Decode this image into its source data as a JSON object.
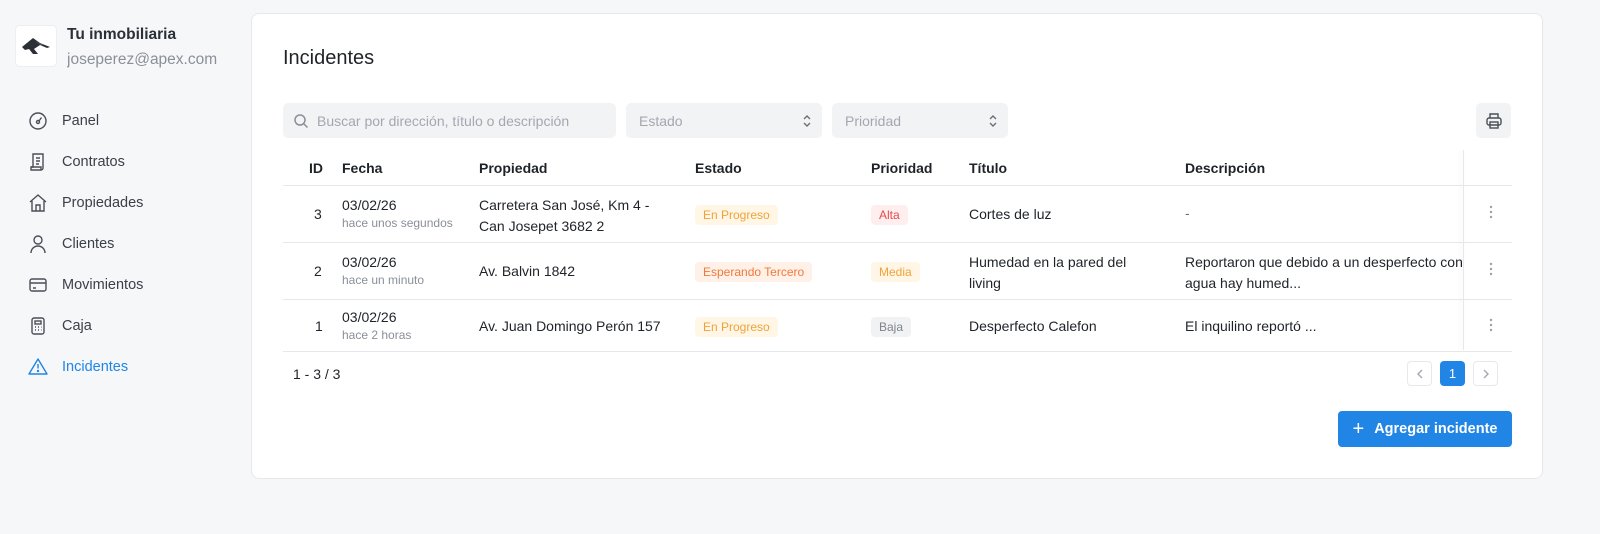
{
  "brand": {
    "name": "Tu inmobiliaria",
    "email": "joseperez@apex.com",
    "logo_icon": "house-logo-icon"
  },
  "nav": [
    {
      "label": "Panel",
      "icon": "gauge-icon",
      "active": false
    },
    {
      "label": "Contratos",
      "icon": "contract-icon",
      "active": false
    },
    {
      "label": "Propiedades",
      "icon": "home-icon",
      "active": false
    },
    {
      "label": "Clientes",
      "icon": "user-icon",
      "active": false
    },
    {
      "label": "Movimientos",
      "icon": "credit-card-icon",
      "active": false
    },
    {
      "label": "Caja",
      "icon": "calculator-icon",
      "active": false
    },
    {
      "label": "Incidentes",
      "icon": "warning-triangle-icon",
      "active": true
    }
  ],
  "page": {
    "title": "Incidentes"
  },
  "filters": {
    "search_placeholder": "Buscar por dirección, título o descripción",
    "estado_placeholder": "Estado",
    "prioridad_placeholder": "Prioridad"
  },
  "table": {
    "headers": [
      "ID",
      "Fecha",
      "Propiedad",
      "Estado",
      "Prioridad",
      "Título",
      "Descripción"
    ],
    "rows": [
      {
        "id": "3",
        "fecha": "03/02/26",
        "hace": "hace unos segundos",
        "propiedad_l1": "Carretera San José, Km 4 -",
        "propiedad_l2": "Can Josepet 3682 2",
        "estado": "En Progreso",
        "prioridad": "Alta",
        "titulo_l1": "Cortes de luz",
        "titulo_l2": "",
        "descripcion_l1": "-",
        "descripcion_l2": ""
      },
      {
        "id": "2",
        "fecha": "03/02/26",
        "hace": "hace un minuto",
        "propiedad_l1": "Av. Balvin 1842",
        "propiedad_l2": "",
        "estado": "Esperando Tercero",
        "prioridad": "Media",
        "titulo_l1": "Humedad en la pared del",
        "titulo_l2": "living",
        "descripcion_l1": "Reportaron que debido a un desperfecto con",
        "descripcion_l2": "agua hay humed..."
      },
      {
        "id": "1",
        "fecha": "03/02/26",
        "hace": "hace 2 horas",
        "propiedad_l1": "Av. Juan Domingo Perón 157",
        "propiedad_l2": "",
        "estado": "En Progreso",
        "prioridad": "Baja",
        "titulo_l1": "Desperfecto Calefon",
        "titulo_l2": "",
        "descripcion_l1": "El inquilino reportó ...",
        "descripcion_l2": ""
      }
    ]
  },
  "pagination": {
    "summary": "1 - 3 / 3",
    "current": "1",
    "prev_icon": "chevron-left-icon",
    "next_icon": "chevron-right-icon"
  },
  "actions": {
    "add_label": "Agregar incidente"
  },
  "colors": {
    "accent": "#2185e6",
    "alta": "#e24b4b",
    "progreso": "#f0a23a",
    "esperando": "#f07a3a"
  }
}
